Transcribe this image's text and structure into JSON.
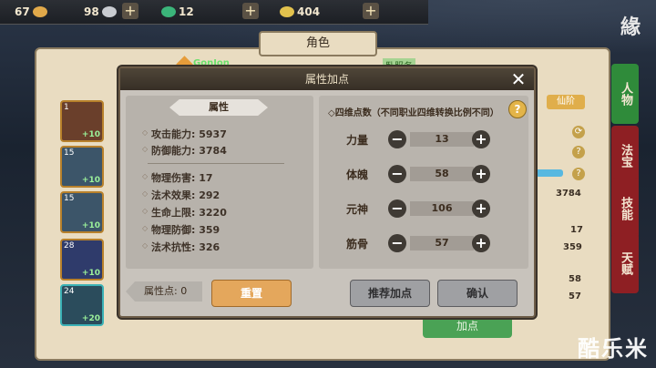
{
  "resources": [
    {
      "value": "67",
      "icon": "gold-ingot-icon",
      "color": "#e1a94a"
    },
    {
      "value": "98",
      "icon": "silver-ingot-icon",
      "color": "#c9ccd1"
    },
    {
      "value": "12",
      "icon": "jade-icon",
      "color": "#3bb57a"
    },
    {
      "value": "404",
      "icon": "coin-icon",
      "color": "#e2c24d"
    }
  ],
  "seal_text": "緣",
  "panel": {
    "title": "角色"
  },
  "equipment": [
    {
      "level": "1",
      "bonus": "+10"
    },
    {
      "level": "15",
      "bonus": "+10"
    },
    {
      "level": "15",
      "bonus": "+10"
    },
    {
      "level": "28",
      "bonus": "+10"
    },
    {
      "level": "24",
      "bonus": "+20"
    }
  ],
  "right_tabs": [
    "人物",
    "法宝",
    "技能",
    "天赋"
  ],
  "background_values": [
    "3784",
    "17",
    "359",
    "58",
    "57"
  ],
  "background_button": "加点",
  "background_gold_button": "仙阶",
  "user": {
    "name": "GonJon",
    "tag": "卧服务"
  },
  "modal": {
    "title": "属性加点",
    "close": "✕",
    "left_title": "属性",
    "stats_top": [
      {
        "label": "攻击能力: 5937"
      },
      {
        "label": "防御能力: 3784"
      }
    ],
    "stats_bottom": [
      {
        "label": "物理伤害: 17"
      },
      {
        "label": "法术效果: 292"
      },
      {
        "label": "生命上限: 3220"
      },
      {
        "label": "物理防御: 359"
      },
      {
        "label": "法术抗性: 326"
      }
    ],
    "four_title": "◇四维点数（不同职业四维转换比例不同）",
    "help": "?",
    "attributes": [
      {
        "label": "力量",
        "value": "13"
      },
      {
        "label": "体魄",
        "value": "58"
      },
      {
        "label": "元神",
        "value": "106"
      },
      {
        "label": "筋骨",
        "value": "57"
      }
    ],
    "points_label": "属性点: 0",
    "reset": "重置",
    "recommend": "推荐加点",
    "confirm": "确认"
  },
  "watermark": "酷乐米"
}
